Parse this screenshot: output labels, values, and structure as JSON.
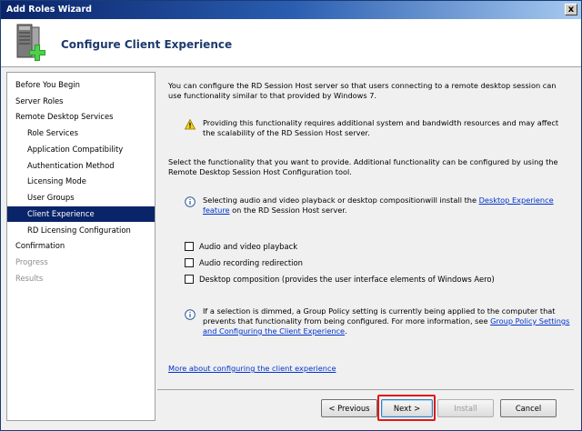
{
  "window": {
    "title": "Add Roles Wizard",
    "close_glyph": "x"
  },
  "header": {
    "title": "Configure Client Experience",
    "icon": "server-add-icon"
  },
  "sidebar": {
    "items": [
      {
        "label": "Before You Begin"
      },
      {
        "label": "Server Roles"
      },
      {
        "label": "Remote Desktop Services"
      },
      {
        "label": "Role Services"
      },
      {
        "label": "Application Compatibility"
      },
      {
        "label": "Authentication Method"
      },
      {
        "label": "Licensing Mode"
      },
      {
        "label": "User Groups"
      },
      {
        "label": "Client Experience"
      },
      {
        "label": "RD Licensing Configuration"
      },
      {
        "label": "Confirmation"
      },
      {
        "label": "Progress"
      },
      {
        "label": "Results"
      }
    ]
  },
  "content": {
    "intro": "You can configure the RD Session Host server so that users connecting to a remote desktop session can use functionality similar to that provided by Windows 7.",
    "warning": "Providing this functionality requires additional system and bandwidth resources and may affect the scalability of the RD Session Host server.",
    "select_text": "Select the functionality that you want to provide. Additional functionality can be configured by using the Remote Desktop Session Host Configuration tool.",
    "info1_before": "Selecting audio and video playback or desktop compositionwill install the ",
    "info1_link": "Desktop Experience feature",
    "info1_after": " on the RD Session Host server.",
    "checkboxes": [
      {
        "label": "Audio and video playback",
        "checked": false
      },
      {
        "label": "Audio recording redirection",
        "checked": false
      },
      {
        "label": "Desktop composition (provides the user interface elements of Windows Aero)",
        "checked": false
      }
    ],
    "info2_before": "If a selection is dimmed, a Group Policy setting is currently being applied to the computer that prevents that functionality from being configured. For more information, see ",
    "info2_link": "Group Policy Settings and Configuring the Client Experience",
    "info2_after": ".",
    "more_link": "More about configuring the client experience"
  },
  "buttons": {
    "previous": "< Previous",
    "next": "Next >",
    "install": "Install",
    "cancel": "Cancel"
  },
  "colors": {
    "selected_bg": "#0a246a",
    "link": "#0033cc",
    "highlight": "#e01818",
    "heading": "#1e3a6e"
  }
}
